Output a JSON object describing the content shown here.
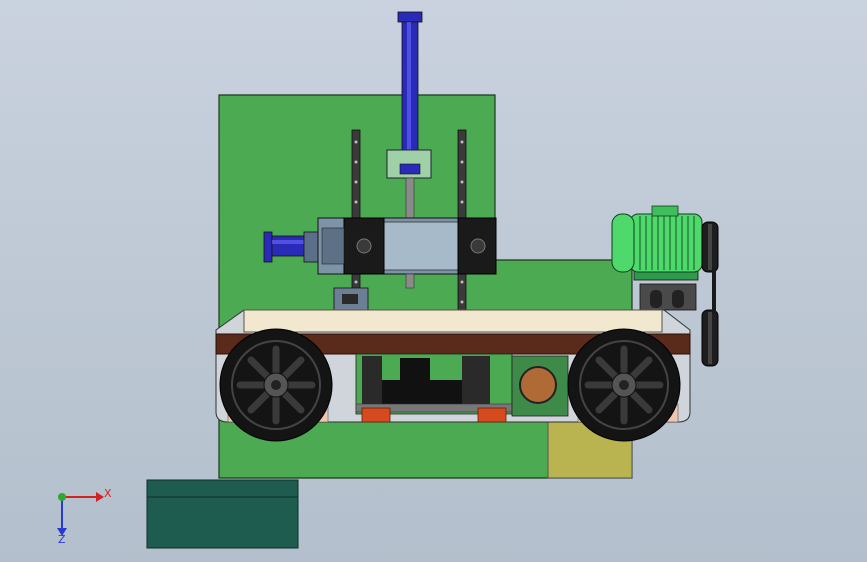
{
  "colors": {
    "background_top": "#c9d2de",
    "background_bottom": "#b3bfcc",
    "base_plate": "#4caa52",
    "cylinder": "#2a2ab8",
    "motor": "#4fd86c",
    "belt": "#5a2a1a",
    "workpiece": "#f2e7cf",
    "wheel": "#141414",
    "orange_block": "#d54a1f",
    "yellow_block": "#b9b450",
    "teal_box": "#1d5c4e",
    "axis_x": "#d42222",
    "axis_y": "#2ea82e",
    "axis_z": "#2a3ad0"
  },
  "icons": {
    "triad": "coordinate-triad-icon"
  },
  "axes": {
    "x_label": "X",
    "z_label": "Z"
  }
}
